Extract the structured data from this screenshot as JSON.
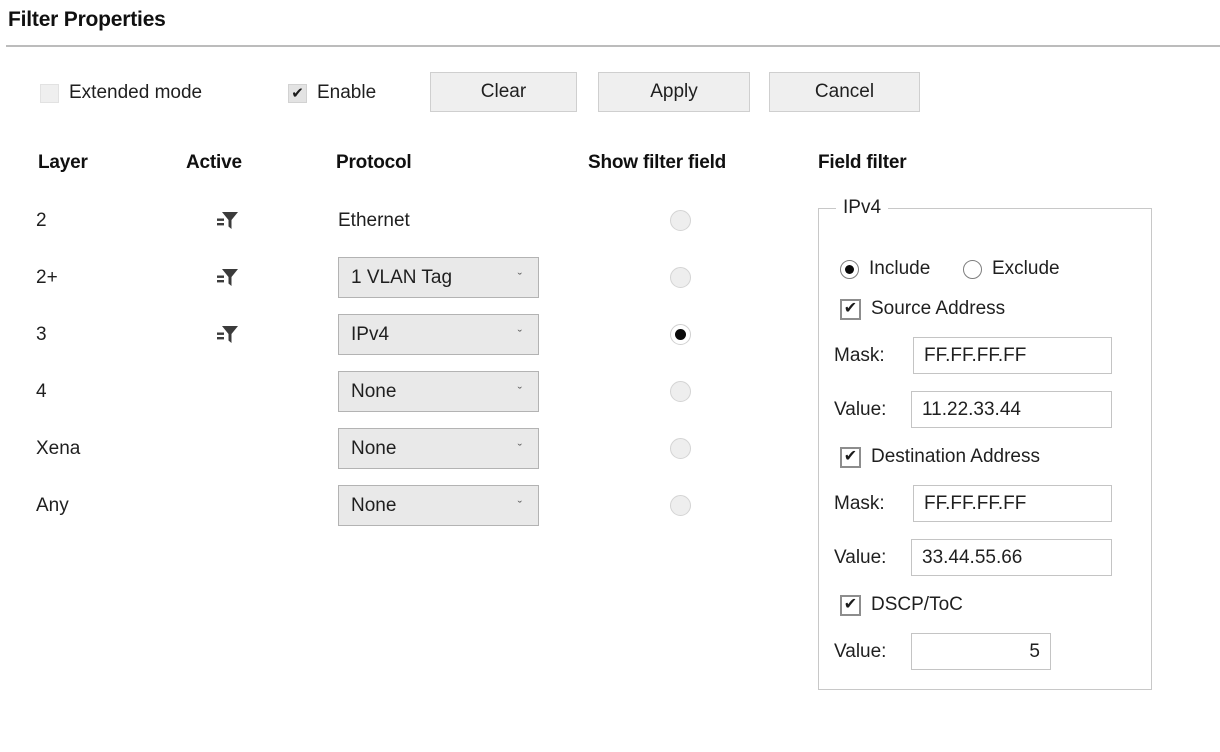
{
  "window": {
    "title": "Filter Properties"
  },
  "toolbar": {
    "extended_mode": {
      "label": "Extended mode",
      "checked": false
    },
    "enable": {
      "label": "Enable",
      "checked": true
    },
    "clear_label": "Clear",
    "apply_label": "Apply",
    "cancel_label": "Cancel"
  },
  "columns": {
    "layer": "Layer",
    "active": "Active",
    "protocol": "Protocol",
    "show_filter_field": "Show filter field",
    "field_filter": "Field filter"
  },
  "rows": [
    {
      "layer": "2",
      "active_icon": "filter-funnel-icon",
      "has_active_icon": true,
      "protocol_kind": "text",
      "protocol": "Ethernet",
      "show_filter_field": false
    },
    {
      "layer": "2+",
      "active_icon": "filter-funnel-icon",
      "has_active_icon": true,
      "protocol_kind": "select",
      "protocol": "1 VLAN Tag",
      "show_filter_field": false
    },
    {
      "layer": "3",
      "active_icon": "filter-funnel-icon",
      "has_active_icon": true,
      "protocol_kind": "select",
      "protocol": "IPv4",
      "show_filter_field": true
    },
    {
      "layer": "4",
      "active_icon": "",
      "has_active_icon": false,
      "protocol_kind": "select",
      "protocol": "None",
      "show_filter_field": false
    },
    {
      "layer": "Xena",
      "active_icon": "",
      "has_active_icon": false,
      "protocol_kind": "select",
      "protocol": "None",
      "show_filter_field": false
    },
    {
      "layer": "Any",
      "active_icon": "",
      "has_active_icon": false,
      "protocol_kind": "select",
      "protocol": "None",
      "show_filter_field": false
    }
  ],
  "field_filter": {
    "group_title": "IPv4",
    "include": {
      "label": "Include",
      "selected": true
    },
    "exclude": {
      "label": "Exclude",
      "selected": false
    },
    "source_address": {
      "label": "Source Address",
      "checked": true
    },
    "source_mask_label": "Mask:",
    "source_mask_value": "FF.FF.FF.FF",
    "source_value_label": "Value:",
    "source_value": "11.22.33.44",
    "destination_address": {
      "label": "Destination Address",
      "checked": true
    },
    "dest_mask_label": "Mask:",
    "dest_mask_value": "FF.FF.FF.FF",
    "dest_value_label": "Value:",
    "dest_value": "33.44.55.66",
    "dscp": {
      "label": "DSCP/ToC",
      "checked": true
    },
    "dscp_value_label": "Value:",
    "dscp_value": "5"
  },
  "icons": {
    "check_glyph": "✔",
    "chevron_down_glyph": "ˇ"
  },
  "colors": {
    "text": "#1f1f1f",
    "rule": "#bcbcbc",
    "button_face": "#efefef",
    "combo_face": "#e9e9e9",
    "border": "#c4c4c4"
  }
}
